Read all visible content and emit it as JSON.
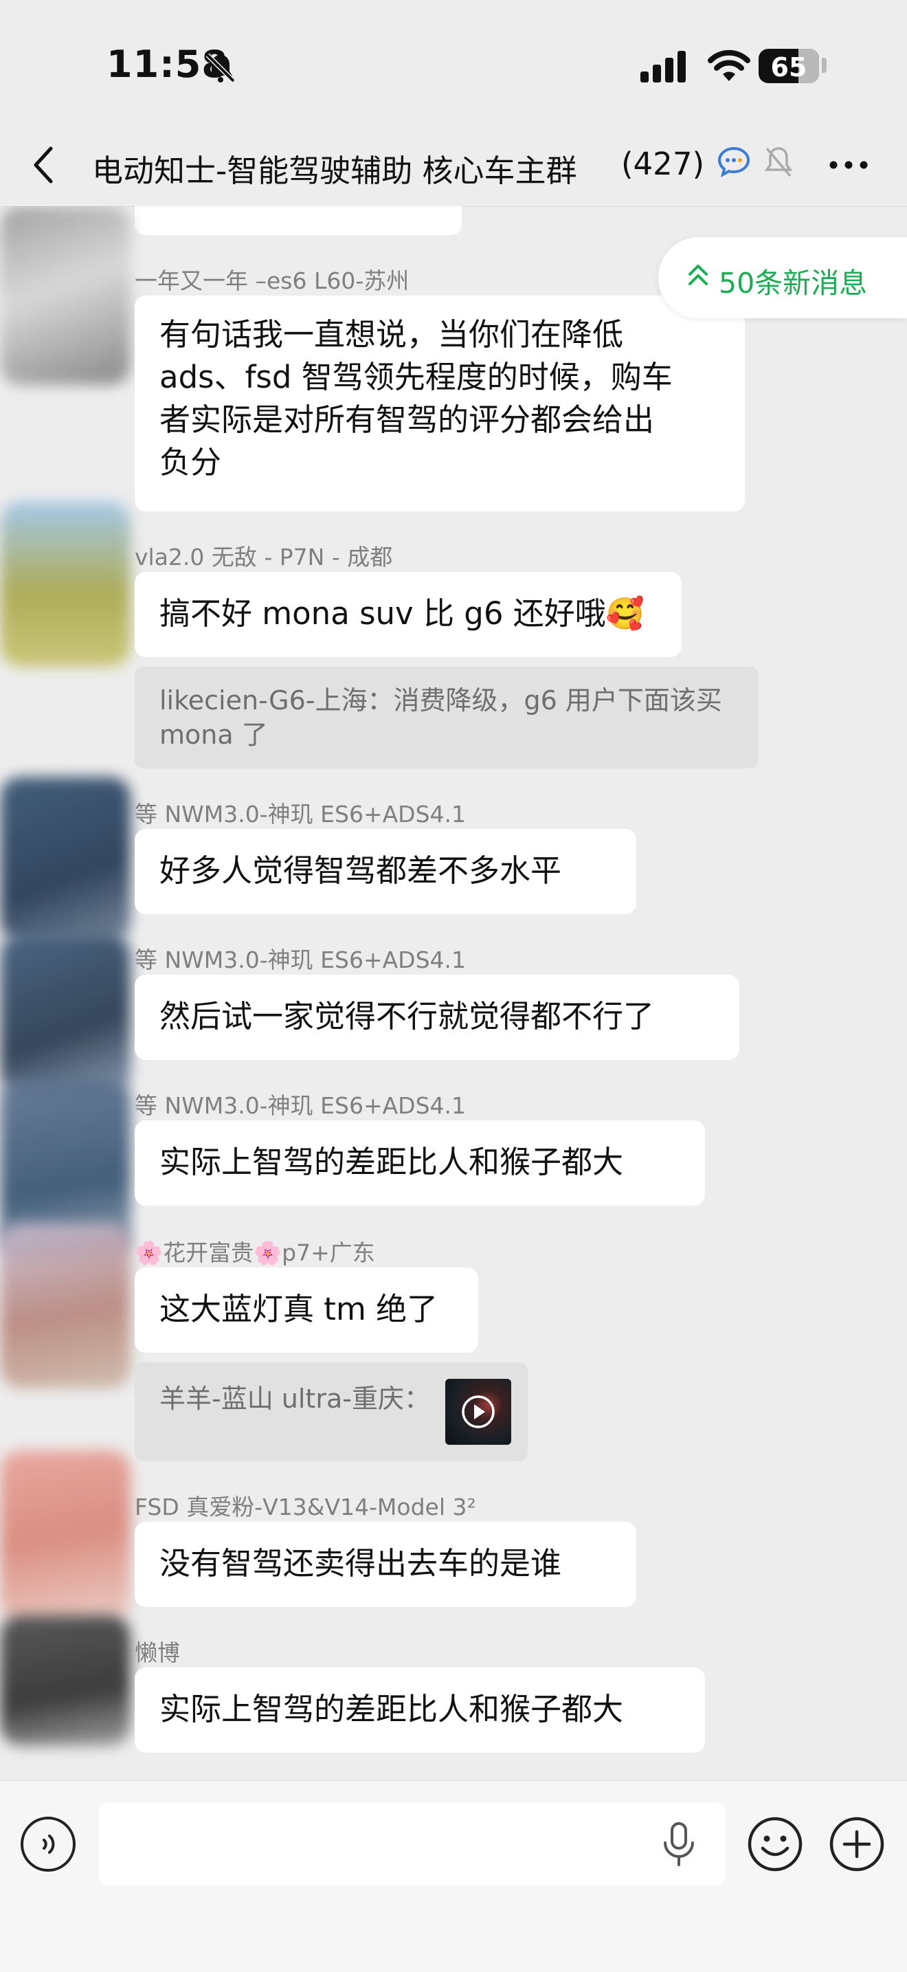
{
  "status_bar": {
    "time": "11:58",
    "battery": "65"
  },
  "header": {
    "title": "电动知士-智能驾驶辅助 核心车主群",
    "member_count": "(427)"
  },
  "new_messages_label": "50条新消息",
  "messages": [
    {
      "sender": "一年又一年 –es6 L60-苏州",
      "text": "有句话我一直想说，当你们在降低\nads、fsd 智驾领先程度的时候，购车\n者实际是对所有智驾的评分都会给出\n负分"
    },
    {
      "sender": "vla2.0 无敌 - P7N - 成都",
      "text": "搞不好 mona suv 比 g6 还好哦🥰",
      "quote": "likecien-G6-上海：消费降级，g6 用户下面该买 mona 了"
    },
    {
      "sender": "等 NWM3.0-神玑 ES6+ADS4.1",
      "text": "好多人觉得智驾都差不多水平"
    },
    {
      "sender": "等 NWM3.0-神玑 ES6+ADS4.1",
      "text": "然后试一家觉得不行就觉得都不行了"
    },
    {
      "sender": "等 NWM3.0-神玑 ES6+ADS4.1",
      "text": "实际上智驾的差距比人和猴子都大"
    },
    {
      "sender": "🌸花开富贵🌸p7+广东",
      "text": "这大蓝灯真 tm 绝了",
      "quote": "羊羊-蓝山 ultra-重庆："
    },
    {
      "sender": "FSD 真爱粉-V13&V14-Model 3²",
      "text": "没有智驾还卖得出去车的是谁"
    },
    {
      "sender": "懒博",
      "text": "实际上智驾的差距比人和猴子都大"
    }
  ],
  "colors": {
    "accent": "#1aad53",
    "background": "#ededed",
    "bubble": "#ffffff"
  },
  "icons": [
    "back-chevron-icon",
    "mute-bell-icon",
    "signal-icon",
    "wifi-icon",
    "chat-bubble-icon",
    "more-icon",
    "voice-icon",
    "mic-icon",
    "emoji-icon",
    "plus-icon",
    "play-icon"
  ]
}
